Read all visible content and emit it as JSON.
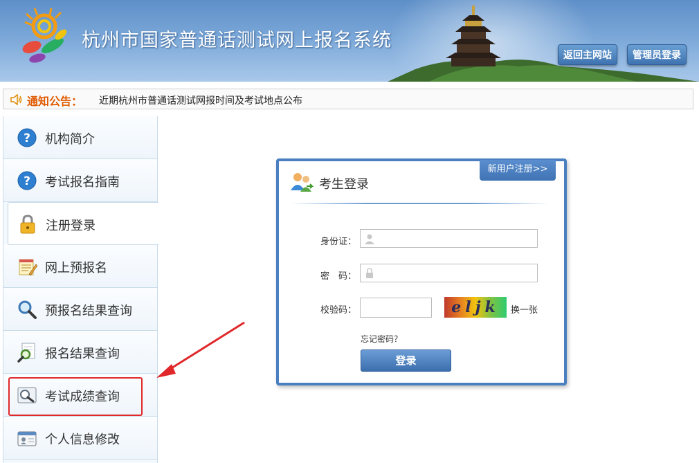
{
  "header": {
    "site_title": "杭州市国家普通话测试网上报名系统",
    "return_button": "返回主网站",
    "admin_button": "管理员登录"
  },
  "notice": {
    "title": "通知公告：",
    "text": "近期杭州市普通话测试网报时间及考试地点公布"
  },
  "sidebar": {
    "items": [
      {
        "label": "机构简介",
        "icon": "help-icon"
      },
      {
        "label": "考试报名指南",
        "icon": "help-icon"
      },
      {
        "label": "注册登录",
        "icon": "lock-icon"
      },
      {
        "label": "网上预报名",
        "icon": "notepad-icon"
      },
      {
        "label": "预报名结果查询",
        "icon": "magnifier-icon"
      },
      {
        "label": "报名结果查询",
        "icon": "search-document-icon"
      },
      {
        "label": "考试成绩查询",
        "icon": "score-search-icon"
      },
      {
        "label": "个人信息修改",
        "icon": "id-card-icon"
      }
    ],
    "active_index": 2,
    "highlighted_index": 6
  },
  "login": {
    "title": "考生登录",
    "register_tab": "新用户注册>>",
    "id_label": "身份证：",
    "password_label": "密　码：",
    "captcha_label": "校验码：",
    "captcha_text": "eljk",
    "refresh_label": "换一张",
    "forgot_label": "忘记密码？",
    "submit_label": "登录",
    "id_value": "",
    "password_value": "",
    "captcha_value": ""
  },
  "colors": {
    "header_blue": "#5e8fc8",
    "card_border": "#4a7fc0",
    "notice_title": "#e05a00",
    "highlight_red": "#e0282a"
  }
}
